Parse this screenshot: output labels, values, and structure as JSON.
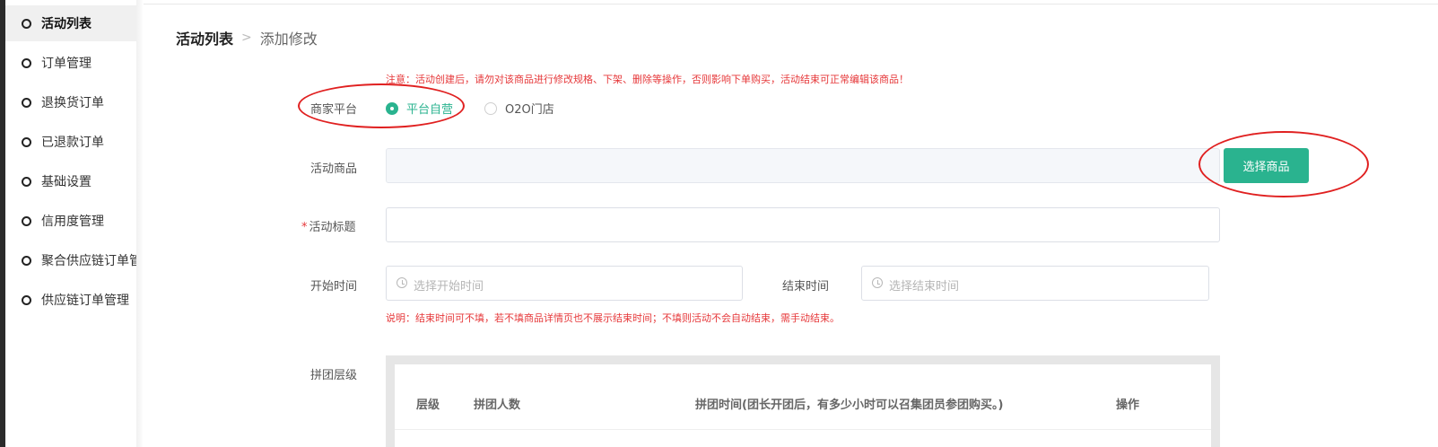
{
  "sidebar": {
    "items": [
      {
        "label": "活动列表",
        "active": true
      },
      {
        "label": "订单管理",
        "active": false
      },
      {
        "label": "退换货订单",
        "active": false
      },
      {
        "label": "已退款订单",
        "active": false
      },
      {
        "label": "基础设置",
        "active": false
      },
      {
        "label": "信用度管理",
        "active": false
      },
      {
        "label": "聚合供应链订单管",
        "active": false
      },
      {
        "label": "供应链订单管理",
        "active": false
      }
    ]
  },
  "breadcrumb": {
    "root": "活动列表",
    "separator": ">",
    "current": "添加修改"
  },
  "notice": "注意：活动创建后，请勿对该商品进行修改规格、下架、删除等操作，否则影响下单购买，活动结束可正常编辑该商品！",
  "form": {
    "platform": {
      "label": "商家平台",
      "options": [
        {
          "label": "平台自营",
          "checked": true
        },
        {
          "label": "O2O门店",
          "checked": false
        }
      ]
    },
    "product": {
      "label": "活动商品",
      "value": "",
      "button": "选择商品"
    },
    "title": {
      "required_mark": "*",
      "label": "活动标题",
      "value": ""
    },
    "start_time": {
      "label": "开始时间",
      "placeholder": "选择开始时间"
    },
    "end_time": {
      "label": "结束时间",
      "placeholder": "选择结束时间"
    },
    "time_note": "说明：结束时间可不填，若不填商品详情页也不展示结束时间；不填则活动不会自动结束，需手动结束。",
    "tiers": {
      "label": "拼团层级",
      "headers": [
        "层级",
        "拼团人数",
        "拼团时间(团长开团后，有多少小时可以召集团员参团购买。)",
        "操作"
      ]
    }
  },
  "colors": {
    "accent": "#2ab38f",
    "warning": "#e6383a",
    "annotation": "#e02020"
  }
}
